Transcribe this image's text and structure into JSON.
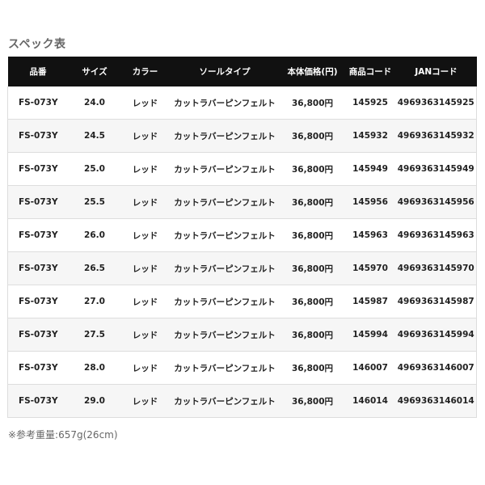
{
  "title": "スペック表",
  "table": {
    "headers": [
      "品番",
      "サイズ",
      "カラー",
      "ソールタイプ",
      "本体価格(円)",
      "商品コード",
      "JANコード"
    ],
    "rows": [
      [
        "FS-073Y",
        "24.0",
        "レッド",
        "カットラバーピンフェルト",
        "36,800円",
        "145925",
        "4969363145925"
      ],
      [
        "FS-073Y",
        "24.5",
        "レッド",
        "カットラバーピンフェルト",
        "36,800円",
        "145932",
        "4969363145932"
      ],
      [
        "FS-073Y",
        "25.0",
        "レッド",
        "カットラバーピンフェルト",
        "36,800円",
        "145949",
        "4969363145949"
      ],
      [
        "FS-073Y",
        "25.5",
        "レッド",
        "カットラバーピンフェルト",
        "36,800円",
        "145956",
        "4969363145956"
      ],
      [
        "FS-073Y",
        "26.0",
        "レッド",
        "カットラバーピンフェルト",
        "36,800円",
        "145963",
        "4969363145963"
      ],
      [
        "FS-073Y",
        "26.5",
        "レッド",
        "カットラバーピンフェルト",
        "36,800円",
        "145970",
        "4969363145970"
      ],
      [
        "FS-073Y",
        "27.0",
        "レッド",
        "カットラバーピンフェルト",
        "36,800円",
        "145987",
        "4969363145987"
      ],
      [
        "FS-073Y",
        "27.5",
        "レッド",
        "カットラバーピンフェルト",
        "36,800円",
        "145994",
        "4969363145994"
      ],
      [
        "FS-073Y",
        "28.0",
        "レッド",
        "カットラバーピンフェルト",
        "36,800円",
        "146007",
        "4969363146007"
      ],
      [
        "FS-073Y",
        "29.0",
        "レッド",
        "カットラバーピンフェルト",
        "36,800円",
        "146014",
        "4969363146014"
      ]
    ]
  },
  "note": "※参考重量:657g(26cm)",
  "colors": {
    "header_bg": "#111111",
    "header_text": "#ffffff",
    "row_alt_bg": "#f6f6f6",
    "title_text": "#666666"
  }
}
